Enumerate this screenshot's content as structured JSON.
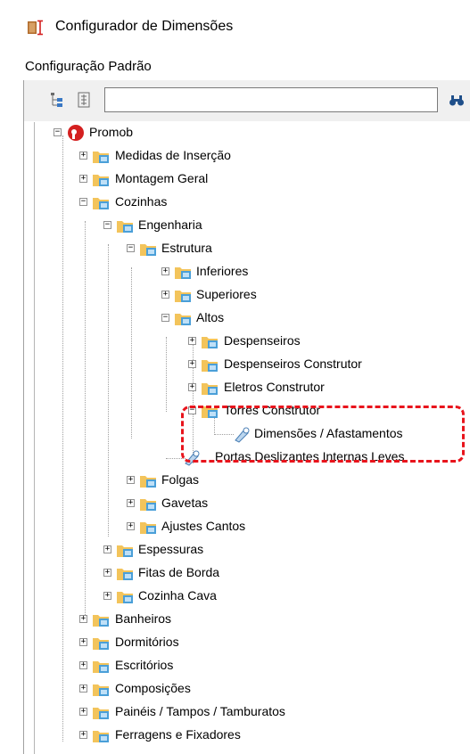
{
  "window": {
    "title": "Configurador de Dimensões"
  },
  "config_label": "Configuração Padrão",
  "toolbar": {
    "search_value": "",
    "icons": [
      "expand-tree-icon",
      "collapse-tree-icon",
      "find-icon"
    ]
  },
  "tree": {
    "root": "Promob",
    "l1": [
      "Medidas de Inserção",
      "Montagem Geral",
      "Cozinhas"
    ],
    "engenharia": "Engenharia",
    "estrutura": "Estrutura",
    "estrutura_children": [
      "Inferiores",
      "Superiores",
      "Altos"
    ],
    "altos_children": [
      "Despenseiros",
      "Despenseiros Construtor",
      "Eletros Construtor",
      "Torres Construtor"
    ],
    "torres_leaf": "Dimensões / Afastamentos",
    "estrutura_leaf": "Portas Deslizantes Internas Leves",
    "engenharia_children": [
      "Folgas",
      "Gavetas",
      "Ajustes Cantos"
    ],
    "cozinhas_children": [
      "Espessuras",
      "Fitas de Borda",
      "Cozinha Cava"
    ],
    "root_more": [
      "Banheiros",
      "Dormitórios",
      "Escritórios",
      "Composições",
      "Painéis / Tampos / Tamburatos",
      "Ferragens e Fixadores"
    ]
  },
  "colors": {
    "folder": "#f3c45b",
    "folder_tab": "#4a9fd8",
    "highlight": "#e8141c",
    "root_icon": "#d42020"
  }
}
